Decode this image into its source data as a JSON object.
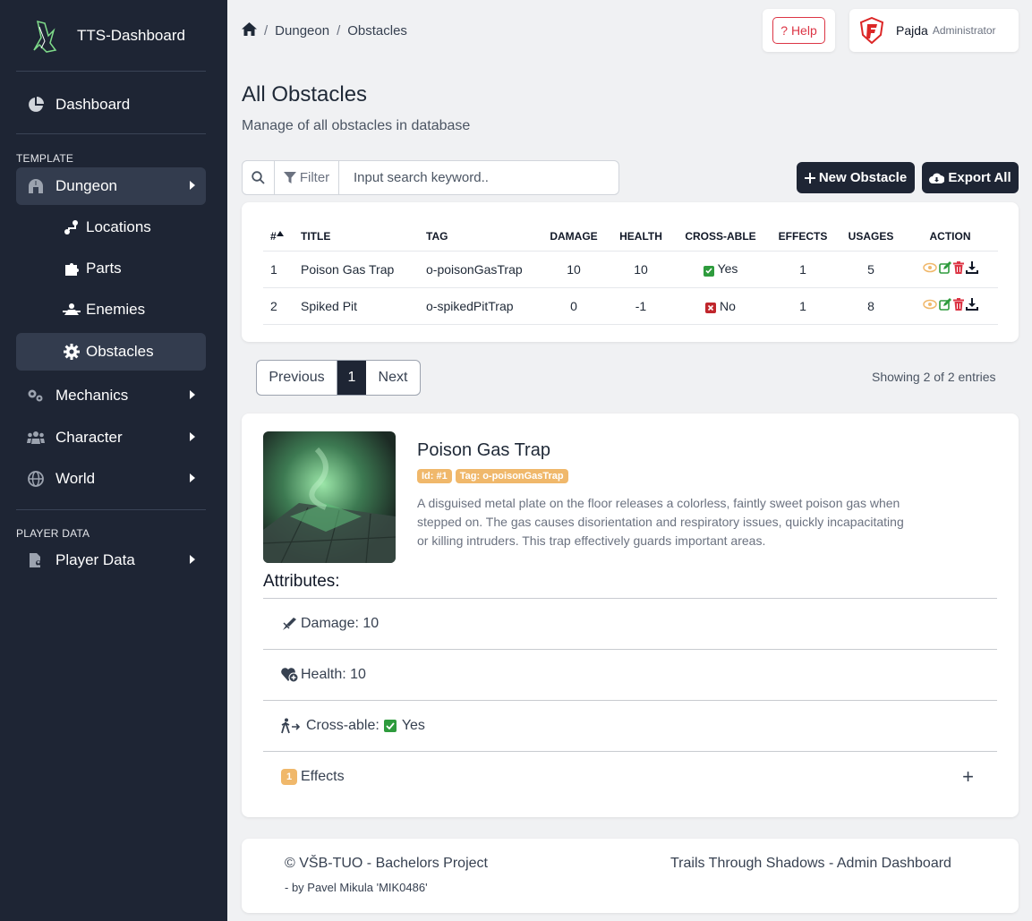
{
  "sidebar": {
    "brand": "TTS-Dashboard",
    "dashboard": "Dashboard",
    "section_template": "TEMPLATE",
    "dungeon": "Dungeon",
    "locations": "Locations",
    "parts": "Parts",
    "enemies": "Enemies",
    "obstacles": "Obstacles",
    "mechanics": "Mechanics",
    "character": "Character",
    "world": "World",
    "section_player": "PLAYER DATA",
    "player_data": "Player Data"
  },
  "breadcrumb": {
    "level1": "Dungeon",
    "level2": "Obstacles"
  },
  "help": {
    "label": "? Help"
  },
  "user": {
    "name": "Pajda",
    "role": "Administrator"
  },
  "page": {
    "title": "All Obstacles",
    "subtitle": "Manage of all obstacles in database"
  },
  "search": {
    "filter": "Filter",
    "placeholder": "Input search keyword.."
  },
  "buttons": {
    "new": "New Obstacle",
    "export": "Export All"
  },
  "table": {
    "headers": {
      "num": "#",
      "title": "TITLE",
      "tag": "TAG",
      "damage": "DAMAGE",
      "health": "HEALTH",
      "crossable": "CROSS-ABLE",
      "effects": "EFFECTS",
      "usages": "USAGES",
      "action": "ACTION"
    },
    "rows": [
      {
        "num": "1",
        "title": "Poison Gas Trap",
        "tag": "o-poisonGasTrap",
        "damage": "10",
        "health": "10",
        "crossable": "Yes",
        "effects": "1",
        "usages": "5"
      },
      {
        "num": "2",
        "title": "Spiked Pit",
        "tag": "o-spikedPitTrap",
        "damage": "0",
        "health": "-1",
        "crossable": "No",
        "effects": "1",
        "usages": "8"
      }
    ]
  },
  "pagination": {
    "prev": "Previous",
    "current": "1",
    "next": "Next",
    "showing": "Showing 2 of 2 entries"
  },
  "detail": {
    "title": "Poison Gas Trap",
    "badge_id": "Id: #1",
    "badge_tag": "Tag: o-poisonGasTrap",
    "description": "A disguised metal plate on the floor releases a colorless, faintly sweet poison gas when stepped on. The gas causes disorientation and respiratory issues, quickly incapacitating or killing intruders. This trap effectively guards important areas.",
    "attributes_title": "Attributes:",
    "damage": "Damage: 10",
    "health": "Health: 10",
    "crossable_label": "Cross-able:",
    "crossable_value": "Yes",
    "effects_count": "1",
    "effects_label": "Effects",
    "expand": "+"
  },
  "footer": {
    "copyright": "© VŠB-TUO - Bachelors Project",
    "author": "- by Pavel Mikula 'MIK0486'",
    "app": "Trails Through Shadows - Admin Dashboard"
  },
  "colors": {
    "sidebar": "#1e2534",
    "active": "#333c4e",
    "badge": "#f0b86b",
    "yes": "#2e9b3d",
    "no": "#c0262c",
    "view": "#f0b86b",
    "edit": "#2e9b3d",
    "delete": "#dc3545"
  },
  "icons": [
    "home-icon",
    "pie-chart-icon",
    "dungeon-icon",
    "route-icon",
    "puzzle-icon",
    "enemies-icon",
    "gear-icon",
    "gears-icon",
    "users-icon",
    "globe-icon",
    "file-user-icon",
    "search-icon",
    "filter-icon",
    "plus-icon",
    "cloud-download-icon",
    "eye-icon",
    "edit-icon",
    "trash-icon",
    "download-icon",
    "damage-icon",
    "heart-icon",
    "walk-icon"
  ]
}
